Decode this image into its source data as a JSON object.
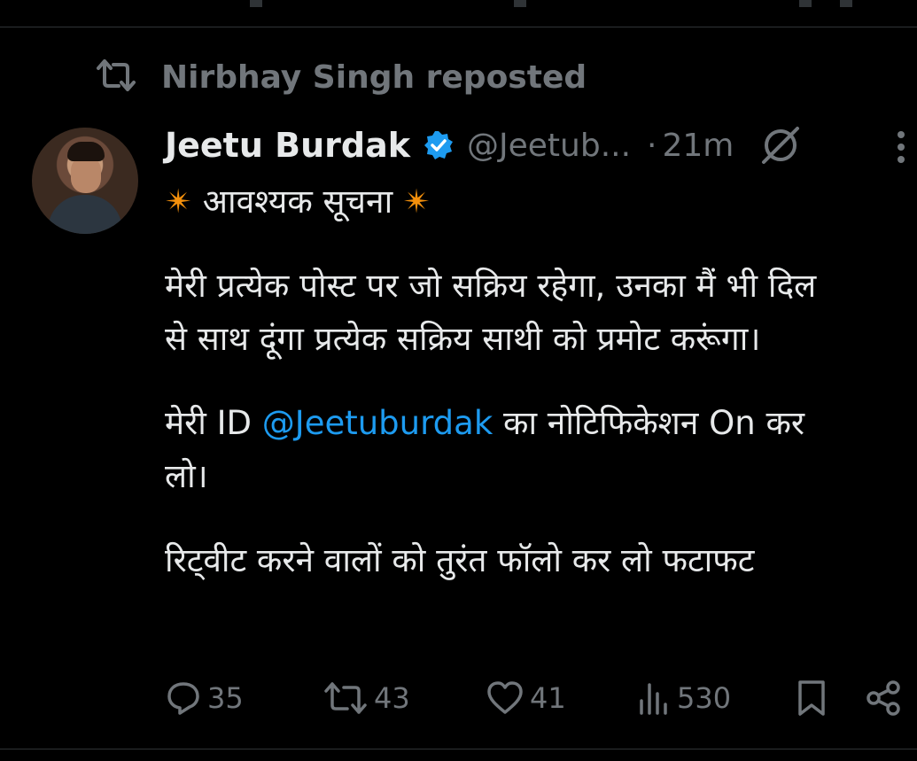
{
  "repost": {
    "text": "Nirbhay Singh reposted"
  },
  "tweet": {
    "author_name": "Jeetu Burdak",
    "handle": "@Jeetub...",
    "separator": "·",
    "time": "21m",
    "lines": {
      "l1_star_left": "✴",
      "l1_text": "आवश्यक सूचना",
      "l1_star_right": "✴",
      "l2": "मेरी प्रत्येक पोस्ट पर जो सक्रिय रहेगा, उनका मैं भी दिल",
      "l3": "से साथ दूंगा प्रत्येक सक्रिय साथी को प्रमोट करूंगा।",
      "l4_pre": "मेरी ID",
      "l4_mention": "@Jeetuburdak",
      "l4_post": "का नोटिफिकेशन On कर",
      "l5": "लो।",
      "l6": "रिट्वीट करने वालों को तुरंत फॉलो कर लो फटाफट"
    }
  },
  "actions": {
    "replies": "35",
    "reposts": "43",
    "likes": "41",
    "views": "530"
  },
  "colors": {
    "background": "#000000",
    "text": "#e7e9ea",
    "muted": "#71767b",
    "link": "#1d9bf0",
    "verified": "#1d9bf0",
    "divider": "#2f3336"
  },
  "icons": [
    "repost-icon",
    "verified-badge-icon",
    "grok-icon",
    "more-icon",
    "reply-icon",
    "retweet-icon",
    "like-icon",
    "views-icon",
    "bookmark-icon",
    "share-icon"
  ]
}
